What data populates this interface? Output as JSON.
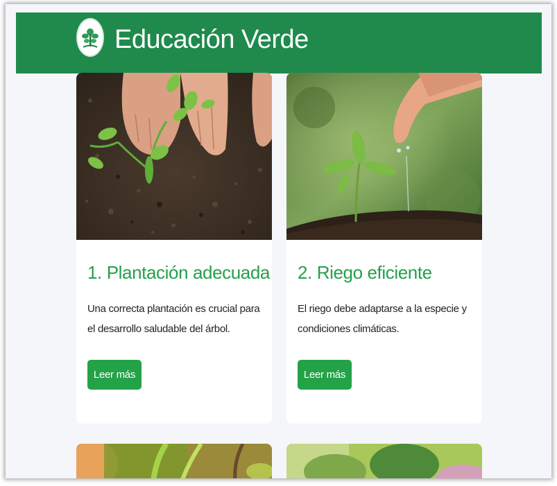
{
  "header": {
    "brand": "Educación Verde",
    "logo_icon": "tree-logo-icon"
  },
  "cards": [
    {
      "title": "1. Plantación adecuada",
      "text": "Una correcta plantación es crucial para el desarrollo saludable del árbol.",
      "button": "Leer más",
      "image": "hands-planting-seedling-photo"
    },
    {
      "title": "2. Riego eficiente",
      "text": "El riego debe adaptarse a la especie y condiciones climáticas.",
      "button": "Leer más",
      "image": "hand-watering-sprout-photo"
    },
    {
      "image": "plant-photo-partial"
    },
    {
      "image": "green-foliage-photo-partial"
    }
  ],
  "colors": {
    "header": "#1f8a4c",
    "accent": "#23a04a",
    "button": "#24a248",
    "background": "#f4f6f9"
  }
}
